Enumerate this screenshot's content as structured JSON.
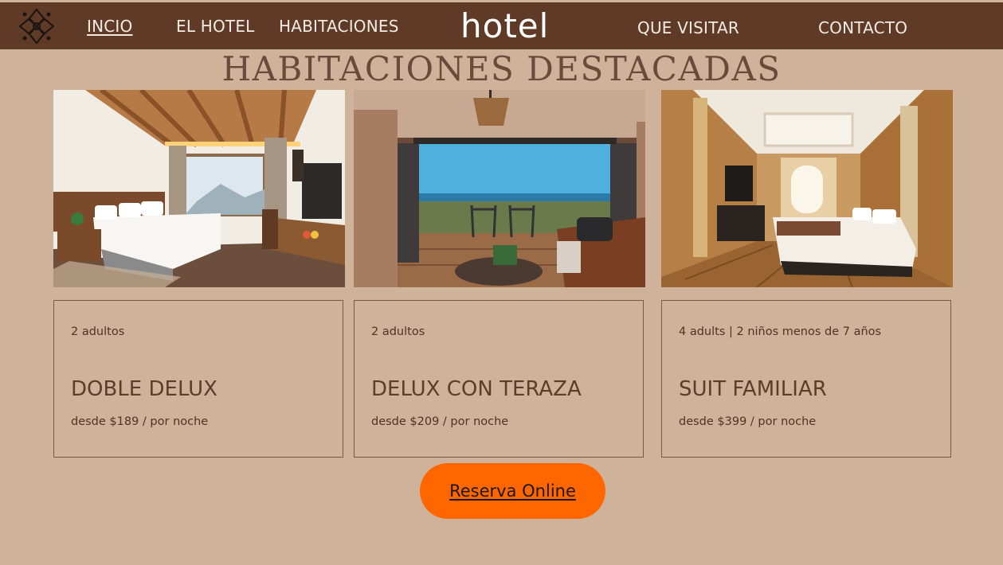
{
  "nav": {
    "links": [
      {
        "label": "INCIO",
        "active": true
      },
      {
        "label": "EL HOTEL"
      },
      {
        "label": "HABITACIONES"
      },
      {
        "label": "QUE VISITAR"
      },
      {
        "label": "CONTACTO"
      }
    ],
    "brand": "hotel",
    "logo_icon": "ornamental-flower-icon"
  },
  "section": {
    "title": "HABITACIONES DESTACADAS"
  },
  "rooms": [
    {
      "guests": "2 adultos",
      "name": "DOBLE DELUX",
      "price": "desde $189 / por noche",
      "photo": "bedroom-mountain-view"
    },
    {
      "guests": "2 adultos",
      "name": "DELUX CON TERAZA",
      "price": "desde $209 / por noche",
      "photo": "terrace-ocean-view"
    },
    {
      "guests": "4 adults | 2 niños menos de 7 años",
      "name": "SUIT FAMILIAR",
      "price": "desde $399 / por noche",
      "photo": "family-suite"
    }
  ],
  "cta": {
    "label": "Reserva Online"
  },
  "colors": {
    "background": "#cfb29a",
    "nav": "#5f3a27",
    "accent": "#ff6600"
  }
}
